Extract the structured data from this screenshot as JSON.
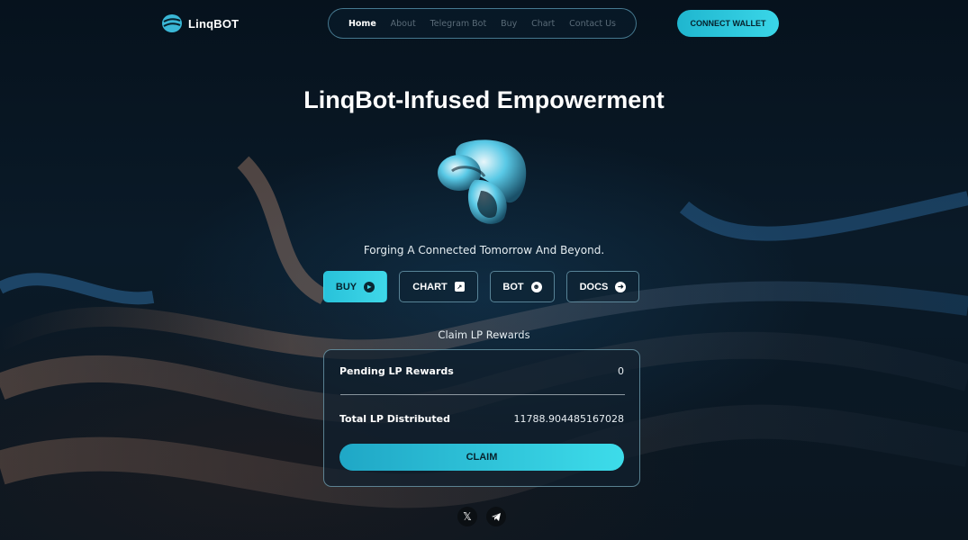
{
  "header": {
    "brand": "LinqBOT",
    "nav": [
      {
        "label": "Home",
        "active": true
      },
      {
        "label": "About",
        "active": false
      },
      {
        "label": "Telegram Bot",
        "active": false
      },
      {
        "label": "Buy",
        "active": false
      },
      {
        "label": "Chart",
        "active": false
      },
      {
        "label": "Contact Us",
        "active": false
      }
    ],
    "connect_label": "CONNECT WALLET"
  },
  "hero": {
    "title": "LinqBot-Infused Empowerment",
    "tagline": "Forging A Connected Tomorrow And Beyond.",
    "buttons": [
      {
        "label": "BUY",
        "icon": "arrow-circle-icon",
        "primary": true
      },
      {
        "label": "CHART",
        "icon": "chart-icon",
        "primary": false
      },
      {
        "label": "BOT",
        "icon": "robot-icon",
        "primary": false
      },
      {
        "label": "DOCS",
        "icon": "arrow-circle-icon",
        "primary": false
      }
    ]
  },
  "claim": {
    "heading": "Claim LP Rewards",
    "pending_label": "Pending LP Rewards",
    "pending_value": "0",
    "total_label": "Total LP Distributed",
    "total_value": "11788.904485167028",
    "button_label": "CLAIM"
  },
  "socials": [
    {
      "icon": "x-icon"
    },
    {
      "icon": "telegram-icon"
    }
  ],
  "colors": {
    "accent": "#3ad6e8",
    "background": "#06121d"
  }
}
